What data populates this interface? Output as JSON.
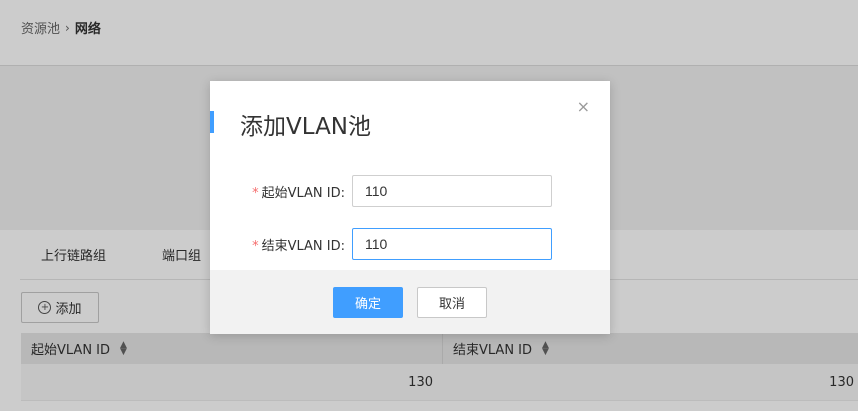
{
  "breadcrumb": {
    "parent": "资源池",
    "separator": "›",
    "current": "网络"
  },
  "tabs": [
    {
      "label": "上行链路组"
    },
    {
      "label": "端口组"
    }
  ],
  "toolbar": {
    "add_label": "添加",
    "add_icon": "plus-circle-icon"
  },
  "table": {
    "columns": [
      "起始VLAN ID",
      "结束VLAN ID"
    ],
    "rows": [
      [
        "130",
        "130"
      ]
    ]
  },
  "modal": {
    "title": "添加VLAN池",
    "close_icon": "×",
    "fields": [
      {
        "label": "起始VLAN ID:",
        "required_mark": "*",
        "value": "110"
      },
      {
        "label": "结束VLAN ID:",
        "required_mark": "*",
        "value": "110"
      }
    ],
    "confirm_label": "确定",
    "cancel_label": "取消"
  },
  "colors": {
    "accent": "#409eff",
    "required": "#f56c6c"
  }
}
